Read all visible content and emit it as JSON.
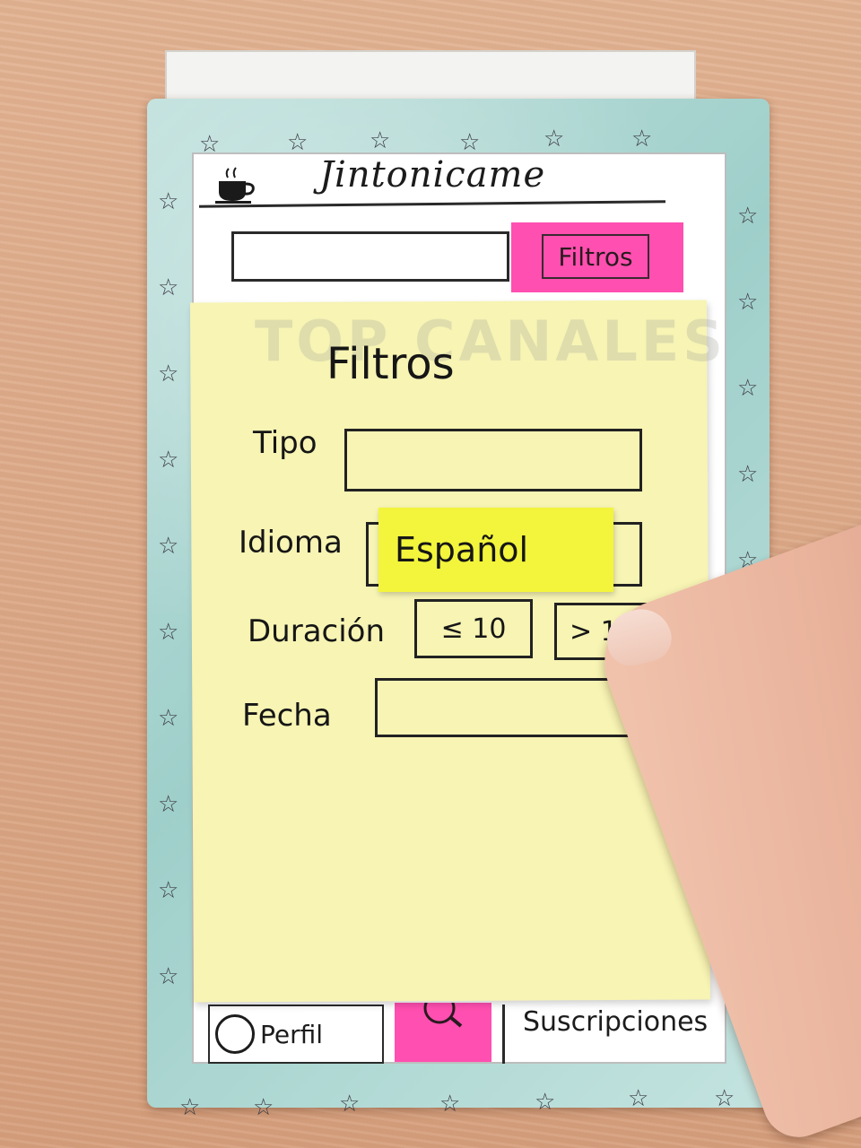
{
  "app": {
    "title": "Jintonicame",
    "logo_icon": "coffee-cup-icon"
  },
  "search": {
    "placeholder": "",
    "filter_button_label": "Filtros"
  },
  "filter_panel": {
    "title": "Filtros",
    "background_text": "TOP CANALES",
    "fields": {
      "tipo": {
        "label": "Tipo",
        "value": ""
      },
      "idioma": {
        "label": "Idioma",
        "value": "Español"
      },
      "duracion": {
        "label": "Duración",
        "option_1": "≤ 10",
        "option_2": "> 1"
      },
      "fecha": {
        "label": "Fecha",
        "value": ""
      }
    }
  },
  "bottom_nav": {
    "profile_label": "Perfil",
    "search_icon": "search-icon",
    "subscriptions_label": "Suscripciones"
  },
  "colors": {
    "accent_pink": "#ff4fb0",
    "sticky_yellow": "#f2f53b",
    "panel_yellow": "#f7f4b4",
    "frame_teal": "#a8d5d0"
  }
}
